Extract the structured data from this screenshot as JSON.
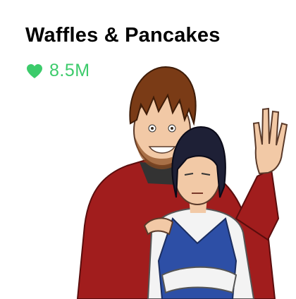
{
  "card": {
    "title": "Waffles & Pancakes",
    "likes": "8.5M",
    "icon": "heart-icon",
    "accent_color": "#3ccb6b"
  },
  "artwork": {
    "depicts": "comic-characters-icon",
    "colors": {
      "hoodie": "#a11d1d",
      "hair_brown": "#7a3b16",
      "hair_dark": "#1e2036",
      "skin": "#f2c9a6",
      "vest": "#2d4fa6",
      "shirt": "#f3f3f3"
    }
  }
}
